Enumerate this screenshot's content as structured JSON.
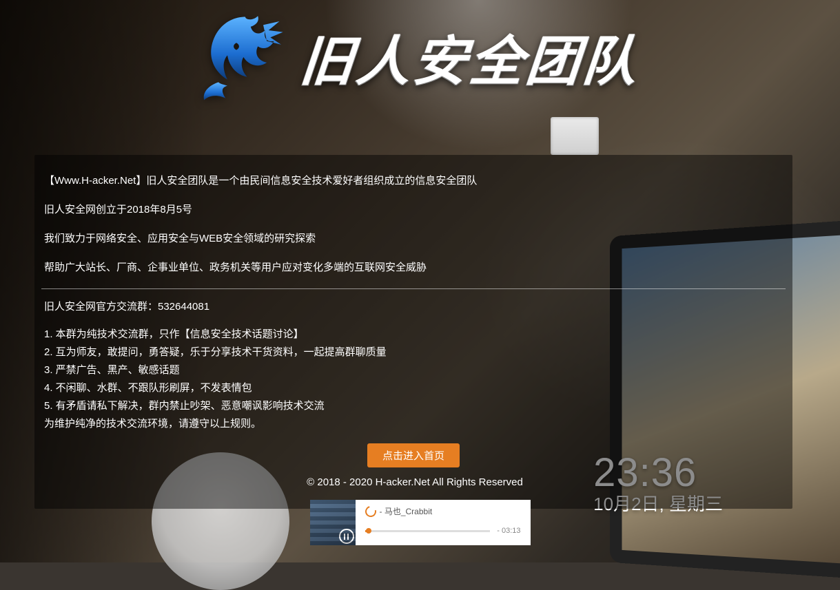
{
  "hero": {
    "title": "旧人安全团队"
  },
  "intro": {
    "line1": "【Www.H-acker.Net】旧人安全团队是一个由民间信息安全技术爱好者组织成立的信息安全团队",
    "line2": "旧人安全网创立于2018年8月5号",
    "line3": "我们致力于网络安全、应用安全与WEB安全领域的研究探索",
    "line4": "帮助广大站长、厂商、企事业单位、政务机关等用户应对变化多端的互联网安全威胁"
  },
  "qq_group": {
    "label": "旧人安全网官方交流群：532644081"
  },
  "rules": {
    "r1": "1. 本群为纯技术交流群，只作【信息安全技术话题讨论】",
    "r2": "2. 互为师友，敢提问，勇答疑，乐于分享技术干货资料，一起提高群聊质量",
    "r3": "3. 严禁广告、黑产、敏感话题",
    "r4": "4. 不闲聊、水群、不跟队形刷屏，不发表情包",
    "r5": "5. 有矛盾请私下解决，群内禁止吵架、恶意嘲讽影响技术交流",
    "r6": "为维护纯净的技术交流环境，请遵守以上规则。"
  },
  "button": {
    "enter": "点击进入首页"
  },
  "footer": {
    "copyright": "© 2018 - 2020 H-acker.Net All Rights Reserved"
  },
  "player": {
    "track": "- 马也_Crabbit",
    "duration": "- 03:13"
  },
  "clock": {
    "time": "23:36",
    "date": "10月2日, 星期三"
  }
}
